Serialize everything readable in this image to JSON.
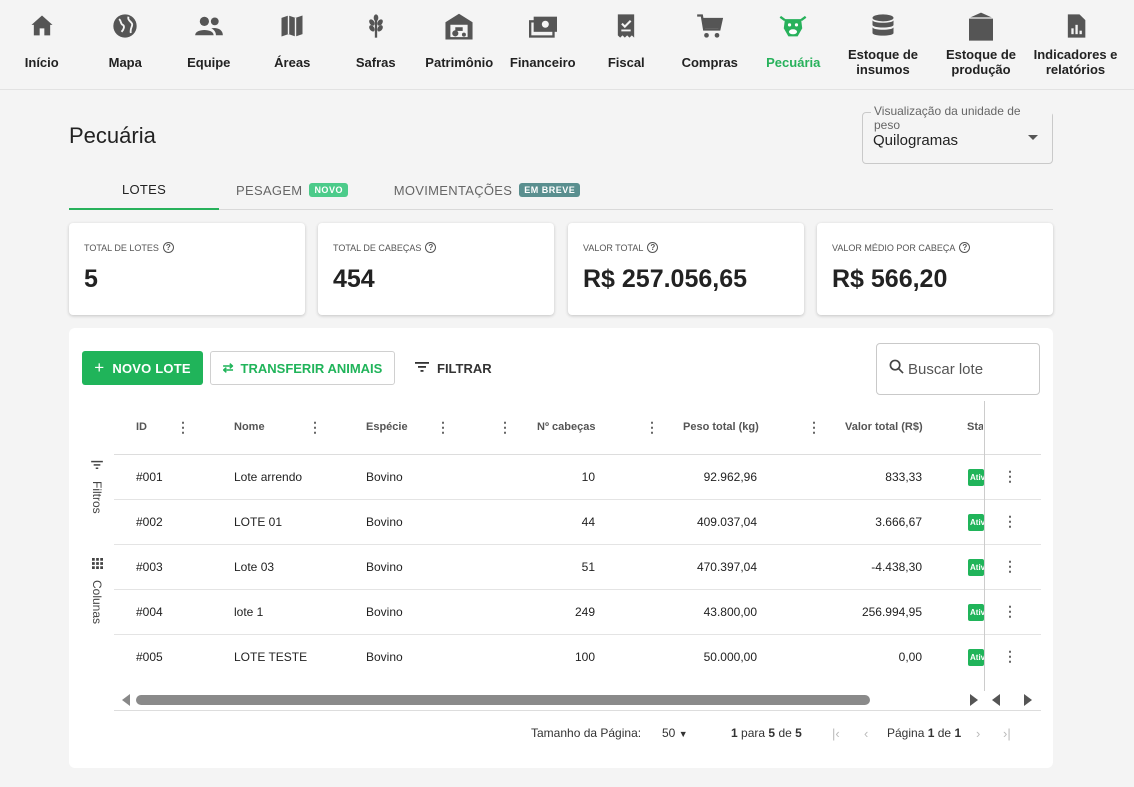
{
  "nav": {
    "items": [
      {
        "label": "Início",
        "icon": "home-icon"
      },
      {
        "label": "Mapa",
        "icon": "globe-icon"
      },
      {
        "label": "Equipe",
        "icon": "people-icon"
      },
      {
        "label": "Áreas",
        "icon": "map-icon"
      },
      {
        "label": "Safras",
        "icon": "wheat-icon"
      },
      {
        "label": "Patrimônio",
        "icon": "tractor-barn-icon"
      },
      {
        "label": "Financeiro",
        "icon": "cash-icon"
      },
      {
        "label": "Fiscal",
        "icon": "receipt-icon"
      },
      {
        "label": "Compras",
        "icon": "cart-icon"
      },
      {
        "label": "Pecuária",
        "icon": "cow-icon"
      },
      {
        "label": "Estoque de insumos",
        "icon": "database-icon"
      },
      {
        "label": "Estoque de produção",
        "icon": "silo-icon"
      },
      {
        "label": "Indicadores e relatórios",
        "icon": "report-icon"
      }
    ],
    "active_color": "#27b15b"
  },
  "page": {
    "title": "Pecuária"
  },
  "unit_select": {
    "label": "Visualização da unidade de peso",
    "value": "Quilogramas"
  },
  "tabs": [
    {
      "label": "LOTES",
      "badge": ""
    },
    {
      "label": "PESAGEM",
      "badge": "NOVO"
    },
    {
      "label": "MOVIMENTAÇÕES",
      "badge": "EM BREVE"
    }
  ],
  "summary": [
    {
      "title": "TOTAL DE LOTES",
      "value": "5"
    },
    {
      "title": "TOTAL DE CABEÇAS",
      "value": "454"
    },
    {
      "title": "VALOR TOTAL",
      "value": "R$ 257.056,65"
    },
    {
      "title": "VALOR MÉDIO POR CABEÇA",
      "value": "R$ 566,20"
    }
  ],
  "toolbar": {
    "new_label": "NOVO LOTE",
    "transfer_label": "TRANSFERIR ANIMAIS",
    "filter_label": "FILTRAR",
    "search_placeholder": "Buscar lote"
  },
  "side_tools": {
    "filters_label": "Filtros",
    "columns_label": "Colunas"
  },
  "table": {
    "headers": {
      "id": "ID",
      "nome": "Nome",
      "especie": "Espécie",
      "cabecas": "Nº cabeças",
      "peso": "Peso total (kg)",
      "valor": "Valor total (R$)",
      "status": "Status"
    },
    "rows": [
      {
        "id": "#001",
        "nome": "Lote arrendo",
        "especie": "Bovino",
        "cabecas": "10",
        "peso": "92.962,96",
        "valor": "833,33",
        "status": "Ativo"
      },
      {
        "id": "#002",
        "nome": "LOTE 01",
        "especie": "Bovino",
        "cabecas": "44",
        "peso": "409.037,04",
        "valor": "3.666,67",
        "status": "Ativo"
      },
      {
        "id": "#003",
        "nome": "Lote 03",
        "especie": "Bovino",
        "cabecas": "51",
        "peso": "470.397,04",
        "valor": "-4.438,30",
        "status": "Ativo"
      },
      {
        "id": "#004",
        "nome": "lote 1",
        "especie": "Bovino",
        "cabecas": "249",
        "peso": "43.800,00",
        "valor": "256.994,95",
        "status": "Ativo"
      },
      {
        "id": "#005",
        "nome": "LOTE TESTE",
        "especie": "Bovino",
        "cabecas": "100",
        "peso": "50.000,00",
        "valor": "0,00",
        "status": "Ativo"
      }
    ]
  },
  "pager": {
    "page_size_label": "Tamanho da Página:",
    "page_size": "50",
    "range_from": "1",
    "range_word": "para",
    "range_to": "5",
    "of_word": "de",
    "total": "5",
    "page_word": "Página",
    "current_page": "1",
    "total_pages": "1"
  }
}
